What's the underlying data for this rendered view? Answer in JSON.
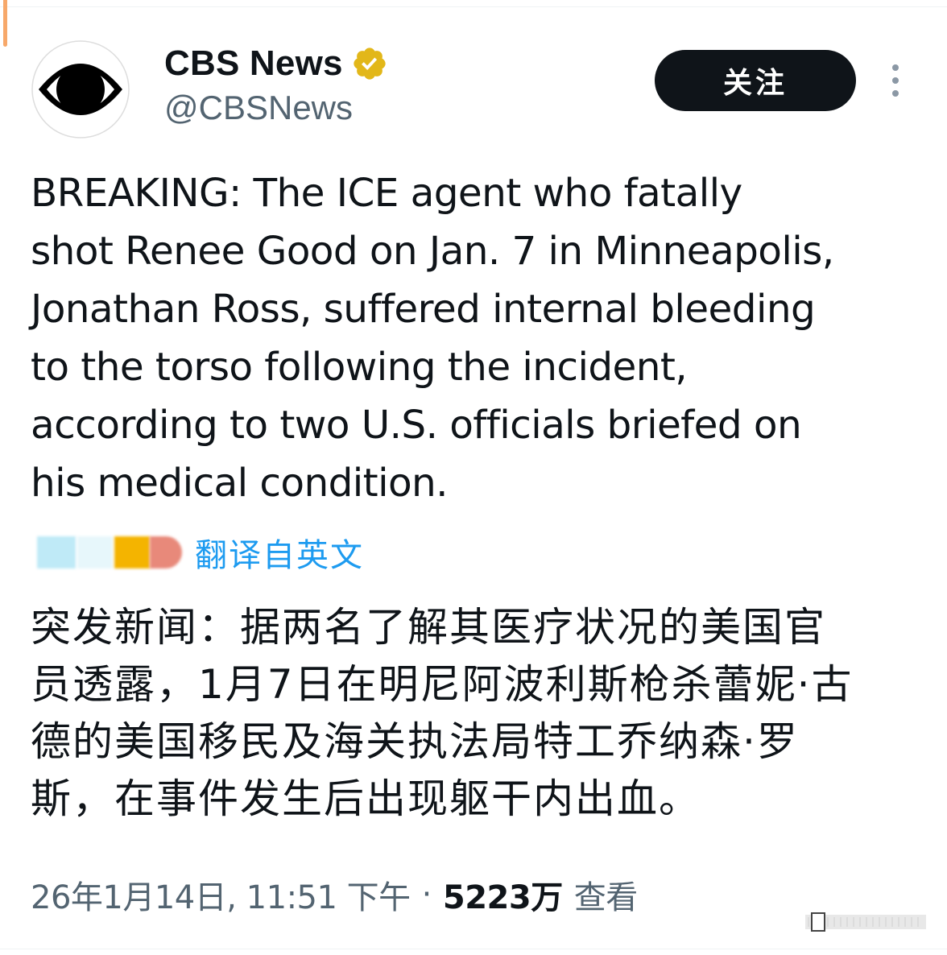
{
  "account": {
    "name": "CBS News",
    "handle": "@CBSNews",
    "avatar_icon": "cbs-eye-logo",
    "verified_icon": "gold-verified-badge",
    "verified_color": "#e2b719"
  },
  "actions": {
    "follow_label": "关注",
    "more_icon": "vertical-ellipsis-icon"
  },
  "tweet": {
    "text_en_lines": [
      "BREAKING: The ICE agent who fatally",
      "shot Renee Good on Jan. 7 in Minneapolis,",
      "Jonathan Ross, suffered internal bleeding",
      "to the torso following the incident,",
      "according to two U.S. officials briefed on",
      "his medical condition."
    ],
    "translate_label": "翻译自英文",
    "text_zh_lines": [
      "突发新闻：据两名了解其医疗状况的美国官",
      "员透露，1月7日在明尼阿波利斯枪杀蕾妮·古",
      "德的美国移民及海关执法局特工乔纳森·罗",
      "斯，在事件发生后出现躯干内出血。"
    ]
  },
  "meta": {
    "timestamp": "26年1月14日, 11:51 下午",
    "separator": "·",
    "views_count": "5223万",
    "views_label": "查看"
  },
  "colors": {
    "text": "#0f1419",
    "secondary": "#536471",
    "link": "#1d9bf0",
    "button_bg": "#0f1419"
  }
}
